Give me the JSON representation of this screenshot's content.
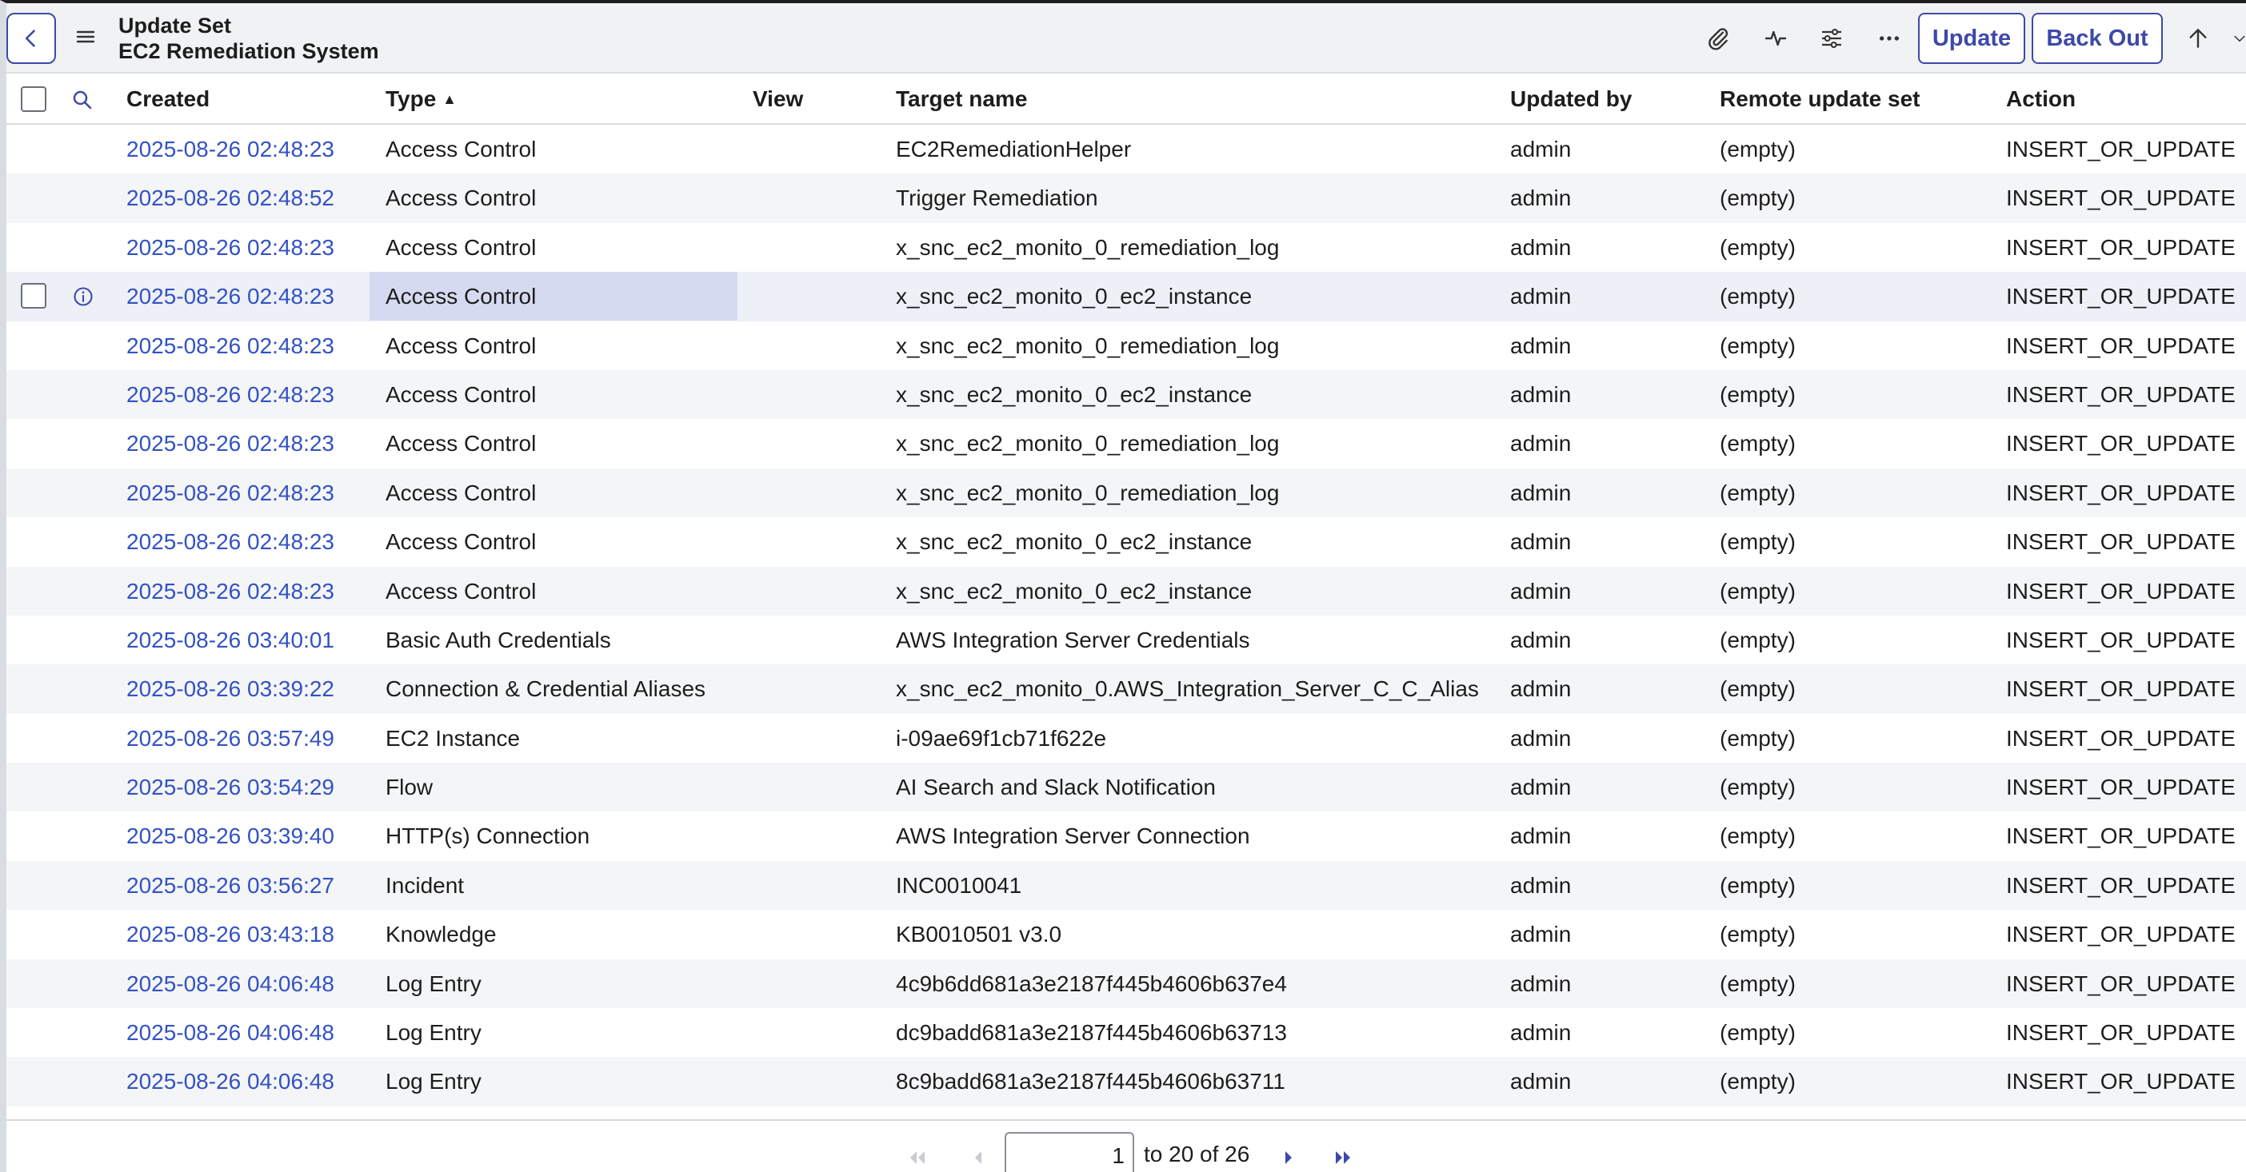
{
  "header": {
    "back_icon": "chevron-left-icon",
    "menu_icon": "hamburger-menu-icon",
    "title_line1": "Update Set",
    "title_line2": "EC2 Remediation System",
    "icons": [
      "paperclip-icon",
      "activity-icon",
      "sliders-icon",
      "more-options-icon"
    ],
    "update_label": "Update",
    "back_out_label": "Back Out",
    "up_icon": "arrow-up-icon",
    "down_icon": "chevron-down-icon"
  },
  "columns": {
    "created": "Created",
    "type": "Type",
    "view": "View",
    "target_name": "Target name",
    "updated_by": "Updated by",
    "remote_update_set": "Remote update set",
    "action": "Action",
    "sort_indicator": "▲"
  },
  "rows": [
    {
      "created": "2025-08-26 02:48:23",
      "type": "Access Control",
      "view": "",
      "target": "EC2RemediationHelper",
      "updated_by": "admin",
      "remote": "(empty)",
      "action": "INSERT_OR_UPDATE"
    },
    {
      "created": "2025-08-26 02:48:52",
      "type": "Access Control",
      "view": "",
      "target": "Trigger Remediation",
      "updated_by": "admin",
      "remote": "(empty)",
      "action": "INSERT_OR_UPDATE"
    },
    {
      "created": "2025-08-26 02:48:23",
      "type": "Access Control",
      "view": "",
      "target": "x_snc_ec2_monito_0_remediation_log",
      "updated_by": "admin",
      "remote": "(empty)",
      "action": "INSERT_OR_UPDATE"
    },
    {
      "created": "2025-08-26 02:48:23",
      "type": "Access Control",
      "view": "",
      "target": "x_snc_ec2_monito_0_ec2_instance",
      "updated_by": "admin",
      "remote": "(empty)",
      "action": "INSERT_OR_UPDATE"
    },
    {
      "created": "2025-08-26 02:48:23",
      "type": "Access Control",
      "view": "",
      "target": "x_snc_ec2_monito_0_remediation_log",
      "updated_by": "admin",
      "remote": "(empty)",
      "action": "INSERT_OR_UPDATE"
    },
    {
      "created": "2025-08-26 02:48:23",
      "type": "Access Control",
      "view": "",
      "target": "x_snc_ec2_monito_0_ec2_instance",
      "updated_by": "admin",
      "remote": "(empty)",
      "action": "INSERT_OR_UPDATE"
    },
    {
      "created": "2025-08-26 02:48:23",
      "type": "Access Control",
      "view": "",
      "target": "x_snc_ec2_monito_0_remediation_log",
      "updated_by": "admin",
      "remote": "(empty)",
      "action": "INSERT_OR_UPDATE"
    },
    {
      "created": "2025-08-26 02:48:23",
      "type": "Access Control",
      "view": "",
      "target": "x_snc_ec2_monito_0_remediation_log",
      "updated_by": "admin",
      "remote": "(empty)",
      "action": "INSERT_OR_UPDATE"
    },
    {
      "created": "2025-08-26 02:48:23",
      "type": "Access Control",
      "view": "",
      "target": "x_snc_ec2_monito_0_ec2_instance",
      "updated_by": "admin",
      "remote": "(empty)",
      "action": "INSERT_OR_UPDATE"
    },
    {
      "created": "2025-08-26 02:48:23",
      "type": "Access Control",
      "view": "",
      "target": "x_snc_ec2_monito_0_ec2_instance",
      "updated_by": "admin",
      "remote": "(empty)",
      "action": "INSERT_OR_UPDATE"
    },
    {
      "created": "2025-08-26 03:40:01",
      "type": "Basic Auth Credentials",
      "view": "",
      "target": "AWS Integration Server Credentials",
      "updated_by": "admin",
      "remote": "(empty)",
      "action": "INSERT_OR_UPDATE"
    },
    {
      "created": "2025-08-26 03:39:22",
      "type": "Connection & Credential Aliases",
      "view": "",
      "target": "x_snc_ec2_monito_0.AWS_Integration_Server_C_C_Alias",
      "updated_by": "admin",
      "remote": "(empty)",
      "action": "INSERT_OR_UPDATE"
    },
    {
      "created": "2025-08-26 03:57:49",
      "type": "EC2 Instance",
      "view": "",
      "target": "i-09ae69f1cb71f622e",
      "updated_by": "admin",
      "remote": "(empty)",
      "action": "INSERT_OR_UPDATE"
    },
    {
      "created": "2025-08-26 03:54:29",
      "type": "Flow",
      "view": "",
      "target": "AI Search and Slack Notification",
      "updated_by": "admin",
      "remote": "(empty)",
      "action": "INSERT_OR_UPDATE"
    },
    {
      "created": "2025-08-26 03:39:40",
      "type": "HTTP(s) Connection",
      "view": "",
      "target": "AWS Integration Server Connection",
      "updated_by": "admin",
      "remote": "(empty)",
      "action": "INSERT_OR_UPDATE"
    },
    {
      "created": "2025-08-26 03:56:27",
      "type": "Incident",
      "view": "",
      "target": "INC0010041",
      "updated_by": "admin",
      "remote": "(empty)",
      "action": "INSERT_OR_UPDATE"
    },
    {
      "created": "2025-08-26 03:43:18",
      "type": "Knowledge",
      "view": "",
      "target": "KB0010501 v3.0",
      "updated_by": "admin",
      "remote": "(empty)",
      "action": "INSERT_OR_UPDATE"
    },
    {
      "created": "2025-08-26 04:06:48",
      "type": "Log Entry",
      "view": "",
      "target": "4c9b6dd681a3e2187f445b4606b637e4",
      "updated_by": "admin",
      "remote": "(empty)",
      "action": "INSERT_OR_UPDATE"
    },
    {
      "created": "2025-08-26 04:06:48",
      "type": "Log Entry",
      "view": "",
      "target": "dc9badd681a3e2187f445b4606b63713",
      "updated_by": "admin",
      "remote": "(empty)",
      "action": "INSERT_OR_UPDATE"
    },
    {
      "created": "2025-08-26 04:06:48",
      "type": "Log Entry",
      "view": "",
      "target": "8c9badd681a3e2187f445b4606b63711",
      "updated_by": "admin",
      "remote": "(empty)",
      "action": "INSERT_OR_UPDATE"
    }
  ],
  "hovered_row_index": 3,
  "pagination": {
    "current_page": "1",
    "range_text": "to 20 of 26",
    "icons": [
      "first-page-icon",
      "previous-page-icon",
      "next-page-icon",
      "last-page-icon"
    ]
  },
  "colors": {
    "accent": "#3d49a8",
    "link": "#3352c4",
    "row_alt": "#f4f5f7",
    "hover_cell": "#d6daf1"
  }
}
